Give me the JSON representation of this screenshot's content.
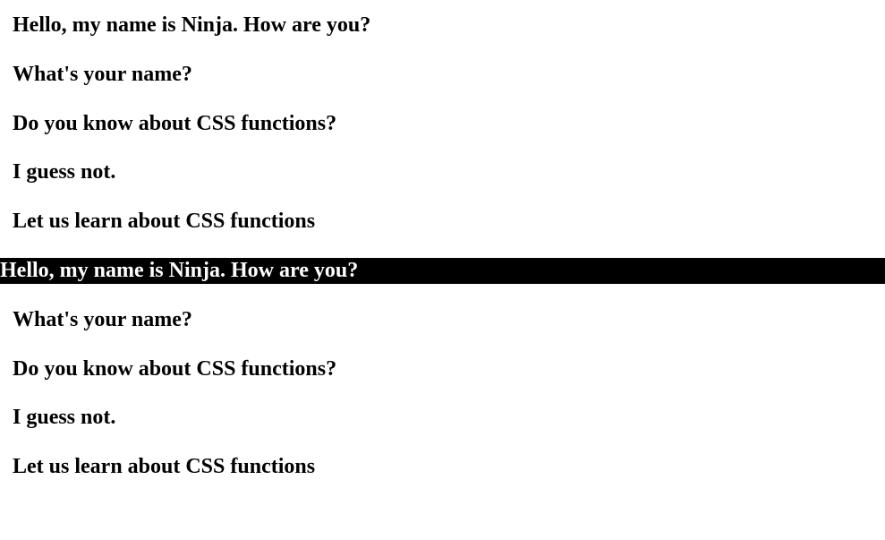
{
  "lines": {
    "l1": "Hello, my name is Ninja. How are you?",
    "l2": "What's your name?",
    "l3": "Do you know about CSS functions?",
    "l4": "I guess not.",
    "l5": "Let us learn about CSS functions",
    "l6": "Hello, my name is Ninja. How are you?",
    "l7": "What's your name?",
    "l8": "Do you know about CSS functions?",
    "l9": "I guess not.",
    "l10": "Let us learn about CSS functions"
  }
}
